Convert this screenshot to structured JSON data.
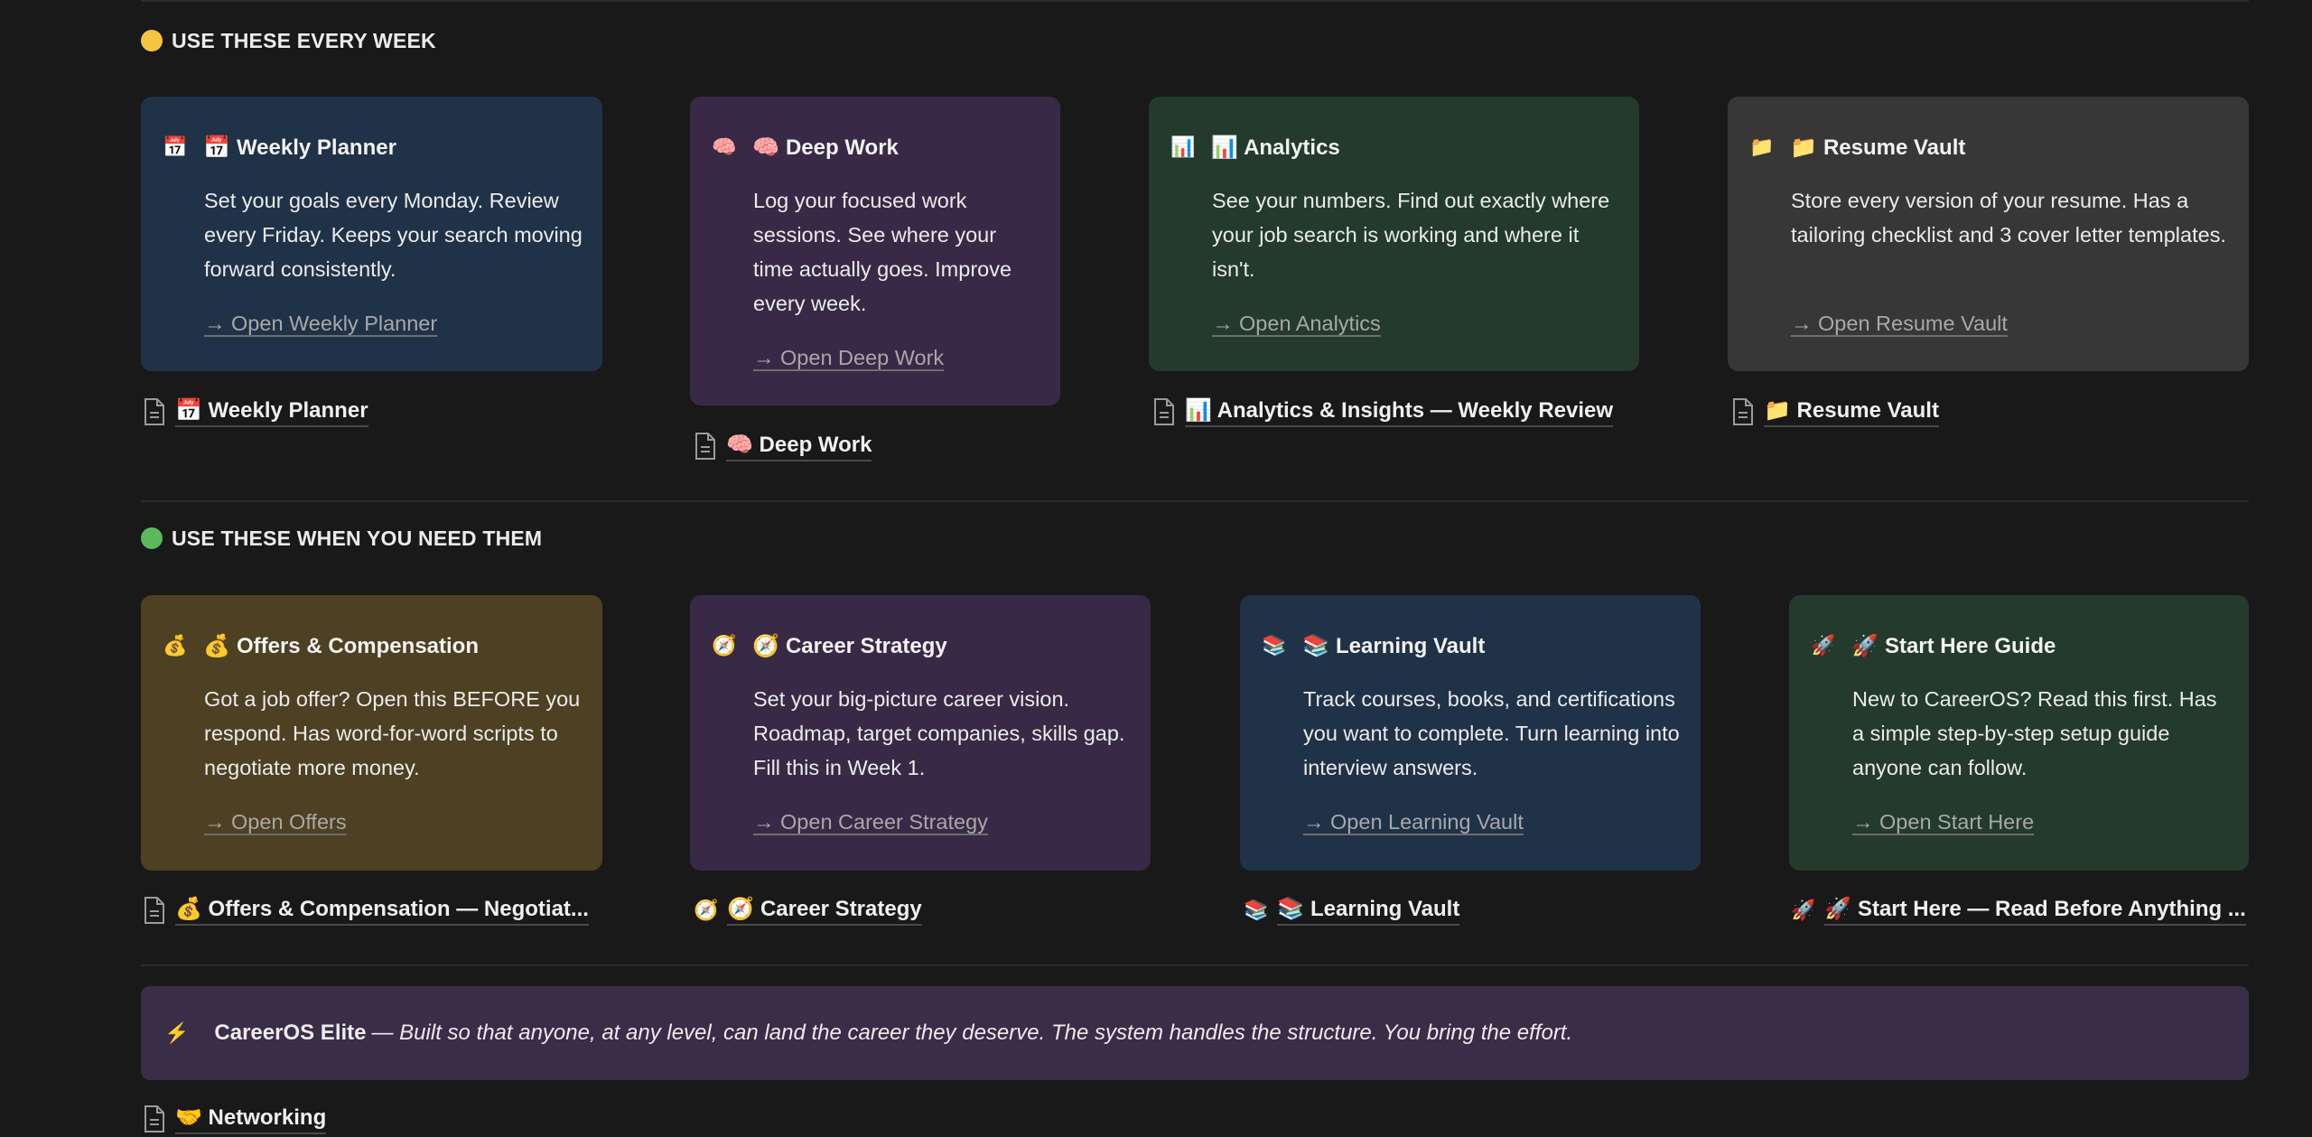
{
  "sections": {
    "weekly": {
      "dot_color": "#f5c542",
      "title": "USE THESE EVERY WEEK"
    },
    "when_needed": {
      "dot_color": "#5cb85c",
      "title": "USE THESE WHEN YOU NEED THEM"
    }
  },
  "cards": [
    {
      "key": "weekly_planner",
      "bg": "#203248",
      "emoji": "📅",
      "title": "📅 Weekly Planner",
      "desc": "Set your goals every Monday. Review every Friday. Keeps your search moving forward consistently.",
      "link": "→ Open Weekly Planner"
    },
    {
      "key": "deep_work",
      "bg": "#382a47",
      "emoji": "🧠",
      "title": "🧠 Deep Work",
      "desc": "Log your focused work sessions. See where your time actually goes. Improve every week.",
      "link": "→ Open Deep Work"
    },
    {
      "key": "analytics",
      "bg": "#233a2d",
      "emoji": "📊",
      "title": "📊 Analytics",
      "desc": "See your numbers. Find out exactly where your job search is working and where it isn't.",
      "link": "→ Open Analytics"
    },
    {
      "key": "resume_vault",
      "bg": "#373737",
      "emoji": "📁",
      "title": "📁 Resume Vault",
      "desc": "Store every version of your resume. Has a tailoring checklist and 3 cover letter templates.",
      "link": "→ Open Resume Vault"
    },
    {
      "key": "offers",
      "bg": "#4e4022",
      "emoji": "💰",
      "title": "💰 Offers & Compensation",
      "desc": "Got a job offer? Open this BEFORE you respond. Has word-for-word scripts to negotiate more money.",
      "link": "→ Open Offers"
    },
    {
      "key": "career_strategy",
      "bg": "#382a47",
      "emoji": "🧭",
      "title": "🧭 Career Strategy",
      "desc": "Set your big-picture career vision. Roadmap, target companies, skills gap. Fill this in Week 1.",
      "link": "→ Open Career Strategy"
    },
    {
      "key": "learning_vault",
      "bg": "#203248",
      "emoji": "📚",
      "title": "📚 Learning Vault",
      "desc": "Track courses, books, and certifications you want to complete. Turn learning into interview answers.",
      "link": "→ Open Learning Vault"
    },
    {
      "key": "start_here",
      "bg": "#233a2d",
      "emoji": "🚀",
      "title": "🚀 Start Here Guide",
      "desc": "New to CareerOS? Read this first. Has a simple step-by-step setup guide anyone can follow.",
      "link": "→ Open Start Here"
    }
  ],
  "page_links": [
    {
      "icon": "doc",
      "label": "📅 Weekly Planner"
    },
    {
      "icon": "doc",
      "label": "🧠 Deep Work"
    },
    {
      "icon": "doc",
      "label": "📊 Analytics & Insights — Weekly Review"
    },
    {
      "icon": "doc",
      "label": "📁 Resume Vault"
    },
    {
      "icon": "doc",
      "label": "💰 Offers & Compensation — Negotiat..."
    },
    {
      "icon": "🧭",
      "label": "🧭 Career Strategy"
    },
    {
      "icon": "📚",
      "label": "📚 Learning Vault"
    },
    {
      "icon": "🚀",
      "label": "🚀 Start Here — Read Before Anything ..."
    },
    {
      "icon": "doc",
      "label": "🤝 Networking"
    }
  ],
  "callout": {
    "icon": "⚡",
    "bold": "CareerOS Elite",
    "italic": "— Built so that anyone, at any level, can land the career they deserve. The system handles the structure. You bring the effort."
  }
}
